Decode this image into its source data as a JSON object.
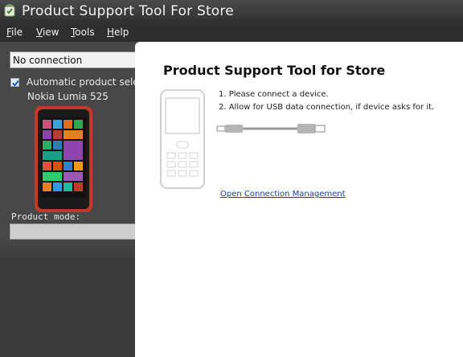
{
  "window": {
    "title": "Product Support Tool For Store"
  },
  "menu": [
    {
      "label": "File",
      "accel": "F",
      "rest": "ile"
    },
    {
      "label": "View",
      "accel": "V",
      "rest": "iew"
    },
    {
      "label": "Tools",
      "accel": "T",
      "rest": "ools"
    },
    {
      "label": "Help",
      "accel": "H",
      "rest": "elp"
    }
  ],
  "sidebar": {
    "connection_value": "No connection",
    "auto_select_label": "Automatic product selection",
    "auto_select_checked": true,
    "device_name": "Nokia Lumia 525",
    "product_mode_label": "Product mode:",
    "product_mode_value": ""
  },
  "main": {
    "title": "Product Support Tool for Store",
    "instructions": [
      "1. Please connect a device.",
      "2. Allow for USB data connection, if device asks for it."
    ],
    "link_text": "Open Connection Management"
  },
  "colors": {
    "accent_link": "#1a3fa6",
    "phone_body": "#c0392b"
  }
}
